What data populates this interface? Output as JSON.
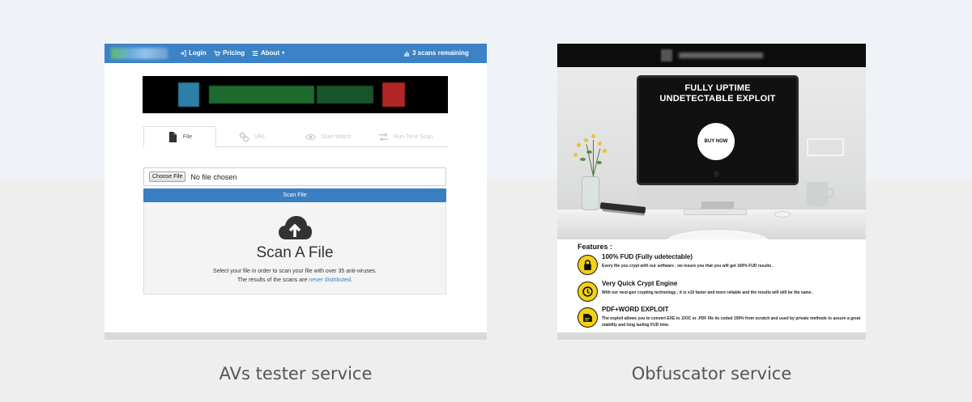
{
  "left_panel": {
    "navbar": {
      "login": "Login",
      "pricing": "Pricing",
      "about": "About",
      "scans_remaining": "3 scans remaining"
    },
    "tabs": [
      {
        "label": "File",
        "icon": "file-icon",
        "active": true
      },
      {
        "label": "URL",
        "icon": "link-icon",
        "active": false
      },
      {
        "label": "Scan Watch",
        "icon": "eye-icon",
        "active": false
      },
      {
        "label": "Run-Time Scan",
        "icon": "exchange-icon",
        "active": false
      }
    ],
    "file_input": {
      "button_label": "Choose File",
      "value": "No file chosen"
    },
    "scan_button": "Scan File",
    "drop": {
      "title": "Scan A File",
      "desc_line1": "Select your file in order to scan your file with over 35 anti-viruses.",
      "desc_line2_prefix": "The results of the scans are ",
      "desc_link": "never distributed",
      "desc_line2_suffix": "."
    },
    "colors": {
      "navbar": "#3b83c6",
      "button": "#3a7fc2"
    }
  },
  "right_panel": {
    "hero": {
      "title_line1": "FULLY UPTIME",
      "title_line2": "UNDETECTABLE EXPLOIT",
      "buy_button": "BUY NOW"
    },
    "features_heading": "Features :",
    "features": [
      {
        "icon": "lock-icon",
        "title": "100% FUD (Fully udetectable)",
        "desc": "Every file you crypt with our software , we insure you that you will get 100% FUD results ."
      },
      {
        "icon": "clock-icon",
        "title": "Very Quick Crypt Engine",
        "desc": "With our next-gen crypting technology , it is x10 faster and more reliable and the results will still be the same ."
      },
      {
        "icon": "document-icon",
        "title": "PDF+WORD EXPLOIT",
        "desc": "The exploit allows you to convert EXE to .DOC or .PDF file its coded 100% from scratch and used by private methods to assure a great stability and long lasting FUD time."
      }
    ],
    "colors": {
      "accent": "#f3d115"
    }
  },
  "captions": {
    "left": "AVs tester service",
    "right": "Obfuscator service"
  }
}
